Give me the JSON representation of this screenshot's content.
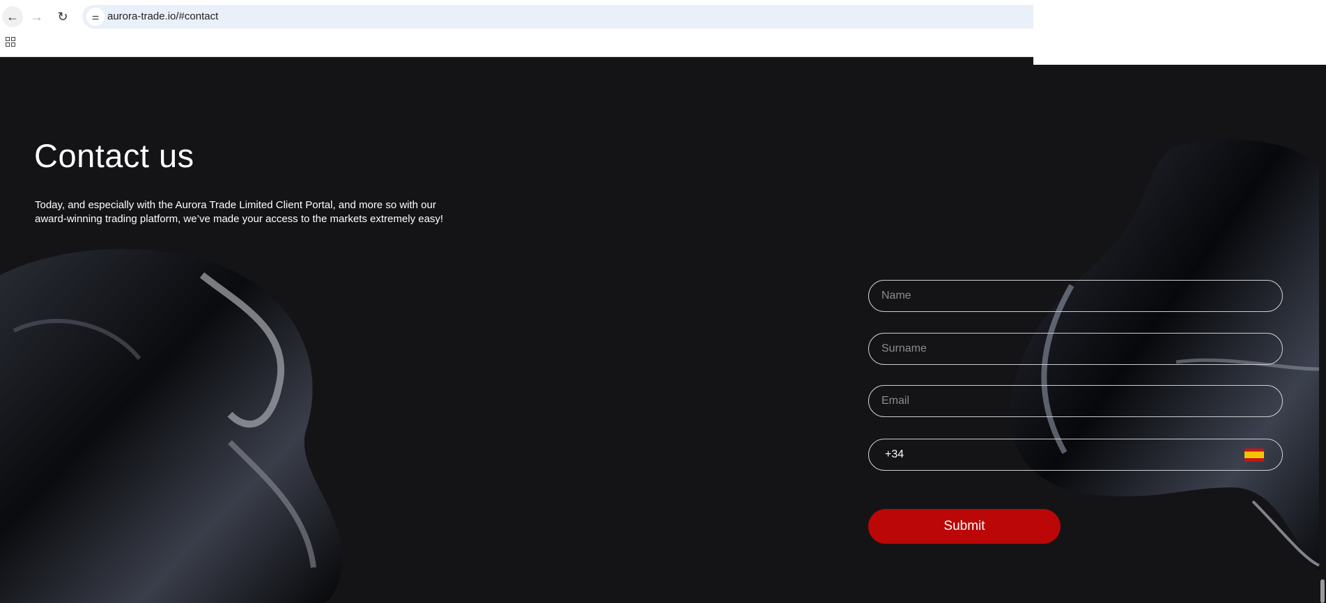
{
  "browser": {
    "url": "aurora-trade.io/#contact"
  },
  "contact": {
    "title": "Contact us",
    "intro": "Today, and especially with the Aurora Trade Limited Client Portal, and more so with our award-winning trading platform, we’ve made your access to the markets extremely easy!"
  },
  "form": {
    "name_placeholder": "Name",
    "surname_placeholder": "Surname",
    "email_placeholder": "Email",
    "phone_code": "+34",
    "submit_label": "Submit"
  },
  "colors": {
    "background": "#141416",
    "accent": "#bb0707"
  }
}
